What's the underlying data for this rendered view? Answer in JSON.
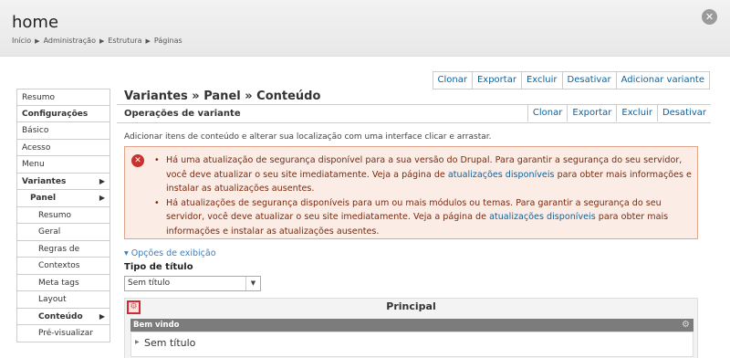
{
  "header": {
    "title": "home",
    "breadcrumb": [
      "Início",
      "Administração",
      "Estrutura",
      "Páginas"
    ],
    "close_glyph": "✕"
  },
  "top_actions": [
    "Clonar",
    "Exportar",
    "Excluir",
    "Desativar",
    "Adicionar variante"
  ],
  "sidebar": {
    "items": [
      {
        "label": "Resumo",
        "level": 0,
        "bold": false,
        "arrow": ""
      },
      {
        "label": "Configurações",
        "level": 0,
        "bold": true,
        "arrow": ""
      },
      {
        "label": "Básico",
        "level": 0,
        "bold": false,
        "arrow": ""
      },
      {
        "label": "Acesso",
        "level": 0,
        "bold": false,
        "arrow": ""
      },
      {
        "label": "Menu",
        "level": 0,
        "bold": false,
        "arrow": ""
      },
      {
        "label": "Variantes",
        "level": 0,
        "bold": true,
        "arrow": "▶"
      },
      {
        "label": "Panel",
        "level": 1,
        "bold": true,
        "arrow": "▶"
      },
      {
        "label": "Resumo",
        "level": 2,
        "bold": false,
        "arrow": ""
      },
      {
        "label": "Geral",
        "level": 2,
        "bold": false,
        "arrow": ""
      },
      {
        "label": "Regras de seleção",
        "level": 2,
        "bold": false,
        "arrow": ""
      },
      {
        "label": "Contextos",
        "level": 2,
        "bold": false,
        "arrow": ""
      },
      {
        "label": "Meta tags",
        "level": 2,
        "bold": false,
        "arrow": ""
      },
      {
        "label": "Layout",
        "level": 2,
        "bold": false,
        "arrow": ""
      },
      {
        "label": "Conteúdo",
        "level": 2,
        "bold": true,
        "arrow": "▶"
      },
      {
        "label": "Pré-visualizar",
        "level": 2,
        "bold": false,
        "arrow": ""
      }
    ]
  },
  "main": {
    "title": "Variantes » Panel » Conteúdo",
    "ops_title": "Operações de variante",
    "ops_actions": [
      "Clonar",
      "Exportar",
      "Excluir",
      "Desativar"
    ],
    "help_text": "Adicionar itens de conteúdo e alterar sua localização com uma interface clicar e arrastar.",
    "error": {
      "icon": "✕",
      "msg1_before": "Há uma atualização de segurança disponível para a sua versão do Drupal. Para garantir a segurança do seu servidor, você deve atualizar o seu site imediatamente. Veja a página de ",
      "msg1_link": "atualizações disponíveis",
      "msg1_after": " para obter mais informações e instalar as atualizações ausentes.",
      "msg2_before": "Há atualizações de segurança disponíveis para um ou mais módulos ou temas. Para garantir a segurança do seu servidor, você deve atualizar o seu site imediatamente. Veja a página de ",
      "msg2_link": "atualizações disponíveis",
      "msg2_after": " para obter mais informações e instalar as atualizações ausentes."
    },
    "display_options": "▾ Opções de exibição",
    "title_type_label": "Tipo de título",
    "title_type_value": "Sem título",
    "select_caret": "▼",
    "region": {
      "title": "Principal",
      "gear": "⚙",
      "pane_title": "Bem vindo",
      "pane_gear": "⚙",
      "pane_tri": "▶",
      "pane_content": "Sem título"
    }
  }
}
